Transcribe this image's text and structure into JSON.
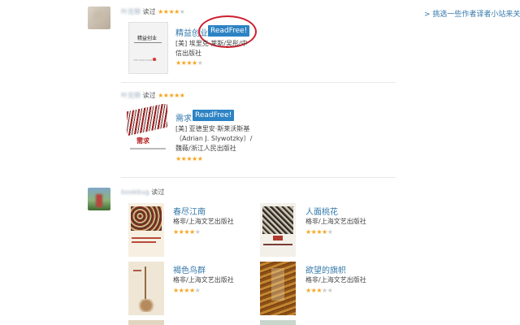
{
  "sidebar": {
    "recommend_link": "> 挑选一些作者译者小站来关"
  },
  "groups": [
    {
      "user": "叶克顿",
      "action": "读过",
      "rating": 4,
      "book": {
        "title": "精益创业",
        "readfree": "ReadFree!",
        "meta_line1": "[美] 埃里克·莱斯/吴彤/中",
        "meta_line2": "信出版社",
        "rating": 4,
        "cover_title": "精益创业",
        "cover_sub": "THE LEAN STARTUP"
      }
    },
    {
      "user": "叶克顿",
      "action": "读过",
      "rating": 5,
      "book": {
        "title": "需求",
        "readfree": "ReadFree!",
        "meta_line1": "[美] 亚德里安·斯莱沃斯基",
        "meta_line2": "（Adrian J. Slywotzky）/",
        "meta_line3": "魏薇/浙江人民出版社",
        "rating": 5,
        "cover_title": "需求"
      }
    },
    {
      "user": "bookbug",
      "action": "读过",
      "books": [
        {
          "title": "春尽江南",
          "meta": "格非/上海文艺出版社",
          "rating": 4
        },
        {
          "title": "人面桃花",
          "meta": "格非/上海文艺出版社",
          "rating": 4
        },
        {
          "title": "褐色鸟群",
          "meta": "格非/上海文艺出版社",
          "rating": 4
        },
        {
          "title": "欲望的旗帜",
          "meta": "格非/上海文艺出版社",
          "rating": 3
        }
      ]
    }
  ],
  "colors": {
    "link": "#3377aa",
    "readfree_bg": "#2d83c4",
    "star": "#f5a623",
    "highlight_circle": "#cc1f2d"
  }
}
